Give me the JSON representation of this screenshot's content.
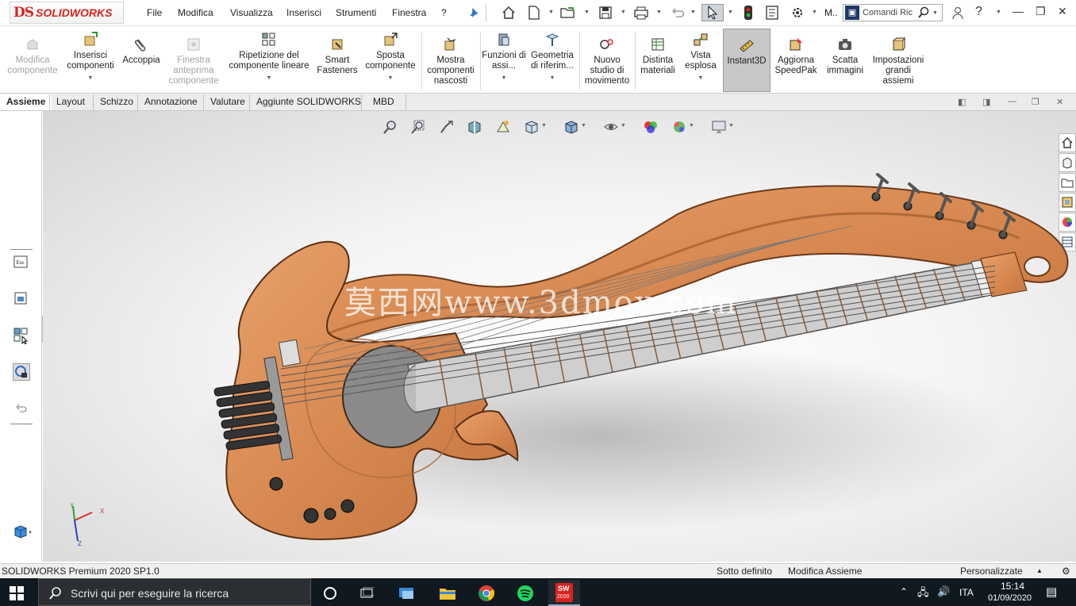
{
  "app": {
    "logo_prefix": "DS",
    "logo_text": "SOLIDWORKS"
  },
  "menu": {
    "items": [
      "File",
      "Modifica",
      "Visualizza",
      "Inserisci",
      "Strumenti",
      "Finestra",
      "?"
    ]
  },
  "quick_access": {
    "search_placeholder": "Comandi Ric",
    "overflow_label": "M.."
  },
  "command_manager": {
    "buttons": [
      {
        "label": "Modifica componente",
        "icon": "edit-component-icon",
        "state": "disabled"
      },
      {
        "label": "Inserisci componenti",
        "icon": "insert-components-icon",
        "state": "normal"
      },
      {
        "label": "Accoppia",
        "icon": "mate-paperclip-icon",
        "state": "normal"
      },
      {
        "label": "Finestra anteprima componente",
        "icon": "preview-window-icon",
        "state": "disabled"
      },
      {
        "label": "Ripetizione del componente lineare",
        "icon": "linear-pattern-icon",
        "state": "normal"
      },
      {
        "label": "Smart Fasteners",
        "icon": "smart-fasteners-icon",
        "state": "normal"
      },
      {
        "label": "Sposta componente",
        "icon": "move-component-icon",
        "state": "normal"
      },
      {
        "label": "Mostra componenti nascosti",
        "icon": "show-hidden-icon",
        "state": "normal"
      },
      {
        "label": "Funzioni di assi...",
        "icon": "assembly-features-icon",
        "state": "normal"
      },
      {
        "label": "Geometria di riferim...",
        "icon": "reference-geometry-icon",
        "state": "normal"
      },
      {
        "label": "Nuovo studio di movimento",
        "icon": "motion-study-icon",
        "state": "normal"
      },
      {
        "label": "Distinta materiali",
        "icon": "bom-icon",
        "state": "normal"
      },
      {
        "label": "Vista esplosa",
        "icon": "exploded-view-icon",
        "state": "normal"
      },
      {
        "label": "Instant3D",
        "icon": "instant3d-icon",
        "state": "active"
      },
      {
        "label": "Aggiorna SpeedPak",
        "icon": "speedpak-icon",
        "state": "normal"
      },
      {
        "label": "Scatta immagini",
        "icon": "camera-icon",
        "state": "normal"
      },
      {
        "label": "Impostazioni grandi assiemi",
        "icon": "large-assembly-icon",
        "state": "normal"
      }
    ]
  },
  "tabs": [
    "Assieme",
    "Layout",
    "Schizzo",
    "Annotazione",
    "Valutare",
    "Aggiunte SOLIDWORKS",
    "MBD"
  ],
  "active_tab": "Assieme",
  "viewport": {
    "watermark": "莫西网www.3dmox.com",
    "triad_labels": {
      "x": "X",
      "y": "Y",
      "z": "Z"
    },
    "model_colors": {
      "wood": "#d88a52",
      "wood_dark": "#a85a2c",
      "fret": "#9a9a9a",
      "string": "#555555"
    }
  },
  "statusbar": {
    "product": "SOLIDWORKS Premium 2020 SP1.0",
    "status": "Sotto definito",
    "mode": "Modifica Assieme",
    "customize": "Personalizzate"
  },
  "taskbar": {
    "search_placeholder": "Scrivi qui per eseguire la ricerca",
    "language": "ITA",
    "time": "15:14",
    "date": "01/09/2020",
    "sw_badge": "2020"
  },
  "colors": {
    "accent_red": "#d9231d",
    "taskbar_bg": "#101820"
  }
}
